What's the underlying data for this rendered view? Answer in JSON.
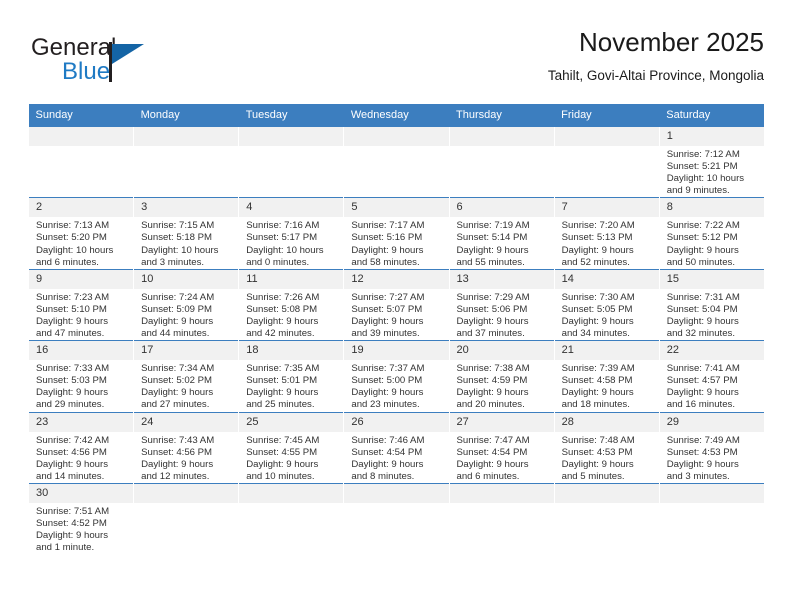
{
  "brand": {
    "name_part1": "General",
    "name_part2": "Blue",
    "mark": "triangle-flag-icon"
  },
  "header": {
    "title": "November 2025",
    "subtitle": "Tahilt, Govi-Altai Province, Mongolia"
  },
  "colors": {
    "header_blue": "#3c7ebf",
    "brand_blue": "#1f7ac4",
    "daynum_bg": "#f1f1f1",
    "text": "#333333"
  },
  "weekdays": [
    "Sunday",
    "Monday",
    "Tuesday",
    "Wednesday",
    "Thursday",
    "Friday",
    "Saturday"
  ],
  "labels": {
    "sunrise_prefix": "Sunrise:",
    "sunset_prefix": "Sunset:",
    "daylight_prefix": "Daylight:"
  },
  "weeks": [
    [
      {
        "day": "",
        "blank": true
      },
      {
        "day": "",
        "blank": true
      },
      {
        "day": "",
        "blank": true
      },
      {
        "day": "",
        "blank": true
      },
      {
        "day": "",
        "blank": true
      },
      {
        "day": "",
        "blank": true
      },
      {
        "day": "1",
        "sunrise": "Sunrise: 7:12 AM",
        "sunset": "Sunset: 5:21 PM",
        "daylight_1": "Daylight: 10 hours",
        "daylight_2": "and 9 minutes."
      }
    ],
    [
      {
        "day": "2",
        "sunrise": "Sunrise: 7:13 AM",
        "sunset": "Sunset: 5:20 PM",
        "daylight_1": "Daylight: 10 hours",
        "daylight_2": "and 6 minutes."
      },
      {
        "day": "3",
        "sunrise": "Sunrise: 7:15 AM",
        "sunset": "Sunset: 5:18 PM",
        "daylight_1": "Daylight: 10 hours",
        "daylight_2": "and 3 minutes."
      },
      {
        "day": "4",
        "sunrise": "Sunrise: 7:16 AM",
        "sunset": "Sunset: 5:17 PM",
        "daylight_1": "Daylight: 10 hours",
        "daylight_2": "and 0 minutes."
      },
      {
        "day": "5",
        "sunrise": "Sunrise: 7:17 AM",
        "sunset": "Sunset: 5:16 PM",
        "daylight_1": "Daylight: 9 hours",
        "daylight_2": "and 58 minutes."
      },
      {
        "day": "6",
        "sunrise": "Sunrise: 7:19 AM",
        "sunset": "Sunset: 5:14 PM",
        "daylight_1": "Daylight: 9 hours",
        "daylight_2": "and 55 minutes."
      },
      {
        "day": "7",
        "sunrise": "Sunrise: 7:20 AM",
        "sunset": "Sunset: 5:13 PM",
        "daylight_1": "Daylight: 9 hours",
        "daylight_2": "and 52 minutes."
      },
      {
        "day": "8",
        "sunrise": "Sunrise: 7:22 AM",
        "sunset": "Sunset: 5:12 PM",
        "daylight_1": "Daylight: 9 hours",
        "daylight_2": "and 50 minutes."
      }
    ],
    [
      {
        "day": "9",
        "sunrise": "Sunrise: 7:23 AM",
        "sunset": "Sunset: 5:10 PM",
        "daylight_1": "Daylight: 9 hours",
        "daylight_2": "and 47 minutes."
      },
      {
        "day": "10",
        "sunrise": "Sunrise: 7:24 AM",
        "sunset": "Sunset: 5:09 PM",
        "daylight_1": "Daylight: 9 hours",
        "daylight_2": "and 44 minutes."
      },
      {
        "day": "11",
        "sunrise": "Sunrise: 7:26 AM",
        "sunset": "Sunset: 5:08 PM",
        "daylight_1": "Daylight: 9 hours",
        "daylight_2": "and 42 minutes."
      },
      {
        "day": "12",
        "sunrise": "Sunrise: 7:27 AM",
        "sunset": "Sunset: 5:07 PM",
        "daylight_1": "Daylight: 9 hours",
        "daylight_2": "and 39 minutes."
      },
      {
        "day": "13",
        "sunrise": "Sunrise: 7:29 AM",
        "sunset": "Sunset: 5:06 PM",
        "daylight_1": "Daylight: 9 hours",
        "daylight_2": "and 37 minutes."
      },
      {
        "day": "14",
        "sunrise": "Sunrise: 7:30 AM",
        "sunset": "Sunset: 5:05 PM",
        "daylight_1": "Daylight: 9 hours",
        "daylight_2": "and 34 minutes."
      },
      {
        "day": "15",
        "sunrise": "Sunrise: 7:31 AM",
        "sunset": "Sunset: 5:04 PM",
        "daylight_1": "Daylight: 9 hours",
        "daylight_2": "and 32 minutes."
      }
    ],
    [
      {
        "day": "16",
        "sunrise": "Sunrise: 7:33 AM",
        "sunset": "Sunset: 5:03 PM",
        "daylight_1": "Daylight: 9 hours",
        "daylight_2": "and 29 minutes."
      },
      {
        "day": "17",
        "sunrise": "Sunrise: 7:34 AM",
        "sunset": "Sunset: 5:02 PM",
        "daylight_1": "Daylight: 9 hours",
        "daylight_2": "and 27 minutes."
      },
      {
        "day": "18",
        "sunrise": "Sunrise: 7:35 AM",
        "sunset": "Sunset: 5:01 PM",
        "daylight_1": "Daylight: 9 hours",
        "daylight_2": "and 25 minutes."
      },
      {
        "day": "19",
        "sunrise": "Sunrise: 7:37 AM",
        "sunset": "Sunset: 5:00 PM",
        "daylight_1": "Daylight: 9 hours",
        "daylight_2": "and 23 minutes."
      },
      {
        "day": "20",
        "sunrise": "Sunrise: 7:38 AM",
        "sunset": "Sunset: 4:59 PM",
        "daylight_1": "Daylight: 9 hours",
        "daylight_2": "and 20 minutes."
      },
      {
        "day": "21",
        "sunrise": "Sunrise: 7:39 AM",
        "sunset": "Sunset: 4:58 PM",
        "daylight_1": "Daylight: 9 hours",
        "daylight_2": "and 18 minutes."
      },
      {
        "day": "22",
        "sunrise": "Sunrise: 7:41 AM",
        "sunset": "Sunset: 4:57 PM",
        "daylight_1": "Daylight: 9 hours",
        "daylight_2": "and 16 minutes."
      }
    ],
    [
      {
        "day": "23",
        "sunrise": "Sunrise: 7:42 AM",
        "sunset": "Sunset: 4:56 PM",
        "daylight_1": "Daylight: 9 hours",
        "daylight_2": "and 14 minutes."
      },
      {
        "day": "24",
        "sunrise": "Sunrise: 7:43 AM",
        "sunset": "Sunset: 4:56 PM",
        "daylight_1": "Daylight: 9 hours",
        "daylight_2": "and 12 minutes."
      },
      {
        "day": "25",
        "sunrise": "Sunrise: 7:45 AM",
        "sunset": "Sunset: 4:55 PM",
        "daylight_1": "Daylight: 9 hours",
        "daylight_2": "and 10 minutes."
      },
      {
        "day": "26",
        "sunrise": "Sunrise: 7:46 AM",
        "sunset": "Sunset: 4:54 PM",
        "daylight_1": "Daylight: 9 hours",
        "daylight_2": "and 8 minutes."
      },
      {
        "day": "27",
        "sunrise": "Sunrise: 7:47 AM",
        "sunset": "Sunset: 4:54 PM",
        "daylight_1": "Daylight: 9 hours",
        "daylight_2": "and 6 minutes."
      },
      {
        "day": "28",
        "sunrise": "Sunrise: 7:48 AM",
        "sunset": "Sunset: 4:53 PM",
        "daylight_1": "Daylight: 9 hours",
        "daylight_2": "and 5 minutes."
      },
      {
        "day": "29",
        "sunrise": "Sunrise: 7:49 AM",
        "sunset": "Sunset: 4:53 PM",
        "daylight_1": "Daylight: 9 hours",
        "daylight_2": "and 3 minutes."
      }
    ],
    [
      {
        "day": "30",
        "sunrise": "Sunrise: 7:51 AM",
        "sunset": "Sunset: 4:52 PM",
        "daylight_1": "Daylight: 9 hours",
        "daylight_2": "and 1 minute."
      },
      {
        "day": "",
        "blank": true
      },
      {
        "day": "",
        "blank": true
      },
      {
        "day": "",
        "blank": true
      },
      {
        "day": "",
        "blank": true
      },
      {
        "day": "",
        "blank": true
      },
      {
        "day": "",
        "blank": true
      }
    ]
  ]
}
